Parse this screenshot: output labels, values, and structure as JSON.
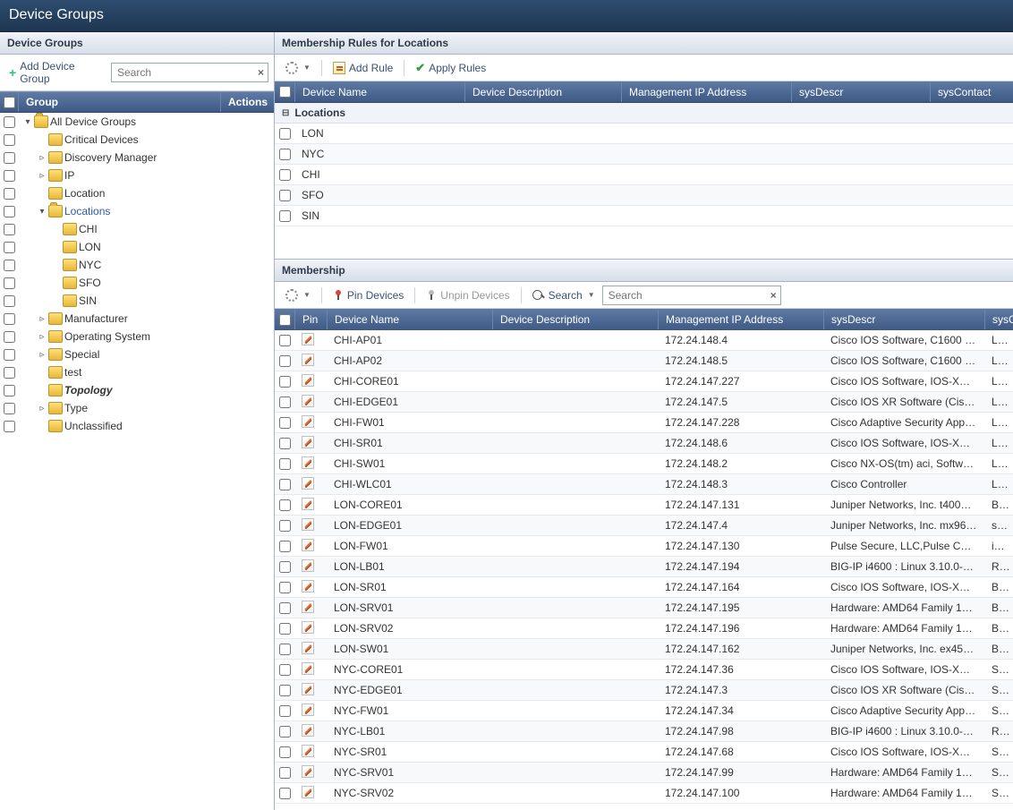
{
  "header": {
    "title": "Device Groups"
  },
  "left": {
    "title": "Device Groups",
    "add_label": "Add Device Group",
    "search_placeholder": "Search",
    "col_group": "Group",
    "col_actions": "Actions",
    "tree": [
      {
        "indent": 0,
        "toggle": "▾",
        "label": "All Device Groups",
        "open": true
      },
      {
        "indent": 1,
        "toggle": "",
        "label": "Critical Devices"
      },
      {
        "indent": 1,
        "toggle": "▹",
        "label": "Discovery Manager"
      },
      {
        "indent": 1,
        "toggle": "▹",
        "label": "IP"
      },
      {
        "indent": 1,
        "toggle": "",
        "label": "Location"
      },
      {
        "indent": 1,
        "toggle": "▾",
        "label": "Locations",
        "sel": true,
        "open": true
      },
      {
        "indent": 2,
        "toggle": "",
        "label": "CHI"
      },
      {
        "indent": 2,
        "toggle": "",
        "label": "LON"
      },
      {
        "indent": 2,
        "toggle": "",
        "label": "NYC"
      },
      {
        "indent": 2,
        "toggle": "",
        "label": "SFO"
      },
      {
        "indent": 2,
        "toggle": "",
        "label": "SIN"
      },
      {
        "indent": 1,
        "toggle": "▹",
        "label": "Manufacturer"
      },
      {
        "indent": 1,
        "toggle": "▹",
        "label": "Operating System"
      },
      {
        "indent": 1,
        "toggle": "▹",
        "label": "Special"
      },
      {
        "indent": 1,
        "toggle": "",
        "label": "test"
      },
      {
        "indent": 1,
        "toggle": "",
        "label": "Topology",
        "bold": true
      },
      {
        "indent": 1,
        "toggle": "▹",
        "label": "Type"
      },
      {
        "indent": 1,
        "toggle": "",
        "label": "Unclassified"
      }
    ]
  },
  "rules": {
    "title": "Membership Rules for Locations",
    "add_rule": "Add Rule",
    "apply_rules": "Apply Rules",
    "cols": [
      "Device Name",
      "Device Description",
      "Management IP Address",
      "sysDescr",
      "sysContact"
    ],
    "group_label": "Locations",
    "rows": [
      "LON",
      "NYC",
      "CHI",
      "SFO",
      "SIN"
    ]
  },
  "membership": {
    "title": "Membership",
    "pin": "Pin Devices",
    "unpin": "Unpin Devices",
    "search_btn": "Search",
    "search_placeholder": "Search",
    "cols": [
      "Pin",
      "Device Name",
      "Device Description",
      "Management IP Address",
      "sysDescr",
      "sysContact"
    ],
    "rows": [
      {
        "name": "CHI-AP01",
        "desc": "",
        "ip": "172.24.148.4",
        "sys": "Cisco IOS Software, C1600 Softw…",
        "c": "Luk"
      },
      {
        "name": "CHI-AP02",
        "desc": "",
        "ip": "172.24.148.5",
        "sys": "Cisco IOS Software, C1600 Softw…",
        "c": "Luk"
      },
      {
        "name": "CHI-CORE01",
        "desc": "",
        "ip": "172.24.147.227",
        "sys": "Cisco IOS Software, IOS-XE Soft…",
        "c": "Luk"
      },
      {
        "name": "CHI-EDGE01",
        "desc": "",
        "ip": "172.24.147.5",
        "sys": "Cisco IOS XR Software (Cisco AS…",
        "c": "Luk"
      },
      {
        "name": "CHI-FW01",
        "desc": "",
        "ip": "172.24.147.228",
        "sys": "Cisco Adaptive Security Appliance…",
        "c": "Luk"
      },
      {
        "name": "CHI-SR01",
        "desc": "",
        "ip": "172.24.148.6",
        "sys": "Cisco IOS Software, IOS-XE Soft…",
        "c": "Luk"
      },
      {
        "name": "CHI-SW01",
        "desc": "",
        "ip": "172.24.148.2",
        "sys": "Cisco NX-OS(tm) aci, Software (a…",
        "c": "Luk"
      },
      {
        "name": "CHI-WLC01",
        "desc": "",
        "ip": "172.24.148.3",
        "sys": "Cisco Controller",
        "c": "Luk"
      },
      {
        "name": "LON-CORE01",
        "desc": "",
        "ip": "172.24.147.131",
        "sys": "Juniper Networks, Inc. t4000 inte…",
        "c": "Bra"
      },
      {
        "name": "LON-EDGE01",
        "desc": "",
        "ip": "172.24.147.4",
        "sys": "Juniper Networks, Inc. mx960 int…",
        "c": "sup"
      },
      {
        "name": "LON-FW01",
        "desc": "",
        "ip": "172.24.147.130",
        "sys": "Pulse Secure, LLC,Pulse Connect …",
        "c": "it@"
      },
      {
        "name": "LON-LB01",
        "desc": "",
        "ip": "172.24.147.194",
        "sys": "BIG-IP i4600 : Linux 3.10.0-862.1…",
        "c": "Rau"
      },
      {
        "name": "LON-SR01",
        "desc": "",
        "ip": "172.24.147.164",
        "sys": "Cisco IOS Software, IOS-XE Soft…",
        "c": "Bra"
      },
      {
        "name": "LON-SRV01",
        "desc": "",
        "ip": "172.24.147.195",
        "sys": "Hardware: AMD64 Family 15 Mod…",
        "c": "Bra"
      },
      {
        "name": "LON-SRV02",
        "desc": "",
        "ip": "172.24.147.196",
        "sys": "Hardware: AMD64 Family 15 Mod…",
        "c": "Bra"
      },
      {
        "name": "LON-SW01",
        "desc": "",
        "ip": "172.24.147.162",
        "sys": "Juniper Networks, Inc. ex4500-40…",
        "c": "Bra"
      },
      {
        "name": "NYC-CORE01",
        "desc": "",
        "ip": "172.24.147.36",
        "sys": "Cisco IOS Software, IOS-XE Soft…",
        "c": "Ste"
      },
      {
        "name": "NYC-EDGE01",
        "desc": "",
        "ip": "172.24.147.3",
        "sys": "Cisco IOS XR Software (Cisco AS…",
        "c": "Ste"
      },
      {
        "name": "NYC-FW01",
        "desc": "",
        "ip": "172.24.147.34",
        "sys": "Cisco Adaptive Security Appliance…",
        "c": "Ste"
      },
      {
        "name": "NYC-LB01",
        "desc": "",
        "ip": "172.24.147.98",
        "sys": "BIG-IP i4600 : Linux 3.10.0-862.1…",
        "c": "Rau"
      },
      {
        "name": "NYC-SR01",
        "desc": "",
        "ip": "172.24.147.68",
        "sys": "Cisco IOS Software, IOS-XE Soft…",
        "c": "Ste"
      },
      {
        "name": "NYC-SRV01",
        "desc": "",
        "ip": "172.24.147.99",
        "sys": "Hardware: AMD64 Family 15 Mod…",
        "c": "Ste"
      },
      {
        "name": "NYC-SRV02",
        "desc": "",
        "ip": "172.24.147.100",
        "sys": "Hardware: AMD64 Family 15 Mod…",
        "c": "Ste"
      }
    ]
  }
}
